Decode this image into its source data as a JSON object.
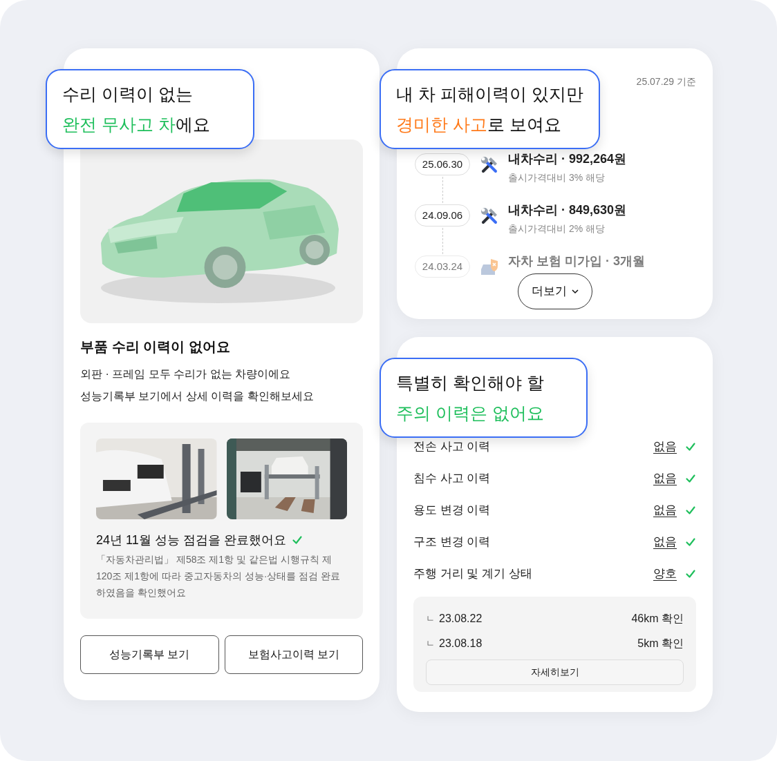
{
  "left_card": {
    "title": "부품 수리 이력이 없어요",
    "description": [
      "외판 · 프레임 모두 수리가 없는 차량이에요",
      "성능기록부 보기에서 상세 이력을 확인해보세요"
    ],
    "inspection": {
      "title": "24년 11월 성능 점검을 완료했어요",
      "verified": true,
      "text": "「자동차관리법」 제58조 제1항 및 같은법 시행규칙 제120조 제1항에 따라 중고자동차의 성능·상태를 점검 완료하였음을 확인했어요"
    },
    "buttons": [
      "성능기록부 보기",
      "보험사고이력 보기"
    ]
  },
  "history_card": {
    "as_of": "25.07.29 기준",
    "entries": [
      {
        "date": "25.06.30",
        "kind": "repair",
        "title": "내차수리 · 992,264원",
        "note": "출시가격대비 3% 해당",
        "faded": false
      },
      {
        "date": "24.09.06",
        "kind": "repair",
        "title": "내차수리 · 849,630원",
        "note": "출시가격대비 2% 해당",
        "faded": false
      },
      {
        "date": "24.03.24",
        "kind": "insurance",
        "title": "자차 보험 미가입 · 3개월",
        "faded": true
      }
    ],
    "more_button": "더보기"
  },
  "checks_card": {
    "rows": [
      {
        "label": "전손 사고 이력",
        "value": "없음",
        "checked": true
      },
      {
        "label": "침수 사고 이력",
        "value": "없음",
        "checked": true
      },
      {
        "label": "용도 변경 이력",
        "value": "없음",
        "checked": true
      },
      {
        "label": "구조 변경 이력",
        "value": "없음",
        "checked": true
      },
      {
        "label": "주행 거리 및 계기 상태",
        "value": "양호",
        "checked": true
      }
    ],
    "mileage": [
      {
        "mark": "ㄴ",
        "date": "23.08.22",
        "reading": "46km 확인"
      },
      {
        "mark": "ㄴ",
        "date": "23.08.18",
        "reading": "5km 확인"
      }
    ],
    "detail_button": "자세히보기"
  },
  "callouts": [
    {
      "lines": [
        [
          {
            "text": "수리 이력이 없는"
          }
        ],
        [
          {
            "text": "완전 무사고 차",
            "color": "#1fbf5c"
          },
          {
            "text": "에요"
          }
        ]
      ]
    },
    {
      "lines": [
        [
          {
            "text": "내 차 피해이력이 있지만"
          }
        ],
        [
          {
            "text": "경미한 사고",
            "color": "#ff7a1a"
          },
          {
            "text": "로 보여요"
          }
        ]
      ]
    },
    {
      "lines": [
        [
          {
            "text": "특별히 확인해야 할"
          }
        ],
        [
          {
            "text": "주의 이력은 없어요",
            "color": "#1fbf5c"
          }
        ]
      ]
    }
  ]
}
